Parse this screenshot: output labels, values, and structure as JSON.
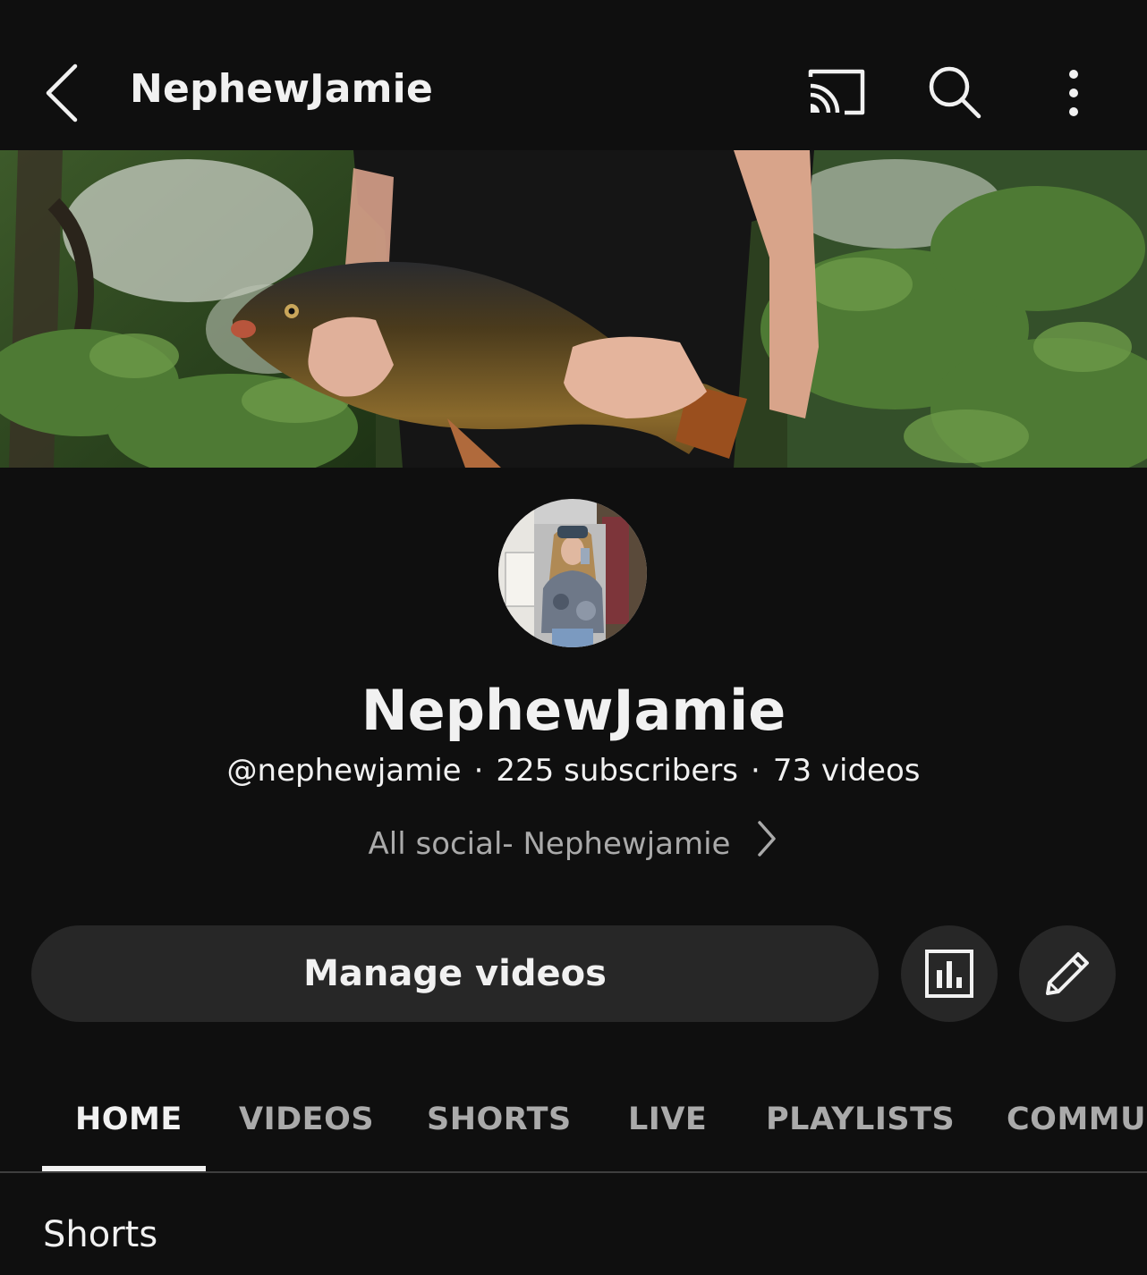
{
  "header": {
    "title": "NephewJamie",
    "icons": [
      "back-arrow-icon",
      "cast-icon",
      "search-icon",
      "more-vert-icon"
    ]
  },
  "channel": {
    "name": "NephewJamie",
    "handle": "@nephewjamie",
    "subscribers": "225 subscribers",
    "videos": "73 videos",
    "separator": "·",
    "link_text": "All social- Nephewjamie"
  },
  "actions": {
    "manage_label": "Manage videos",
    "icons": [
      "analytics-icon",
      "pencil-edit-icon"
    ]
  },
  "tabs": [
    {
      "label": "HOME",
      "active": true
    },
    {
      "label": "VIDEOS",
      "active": false
    },
    {
      "label": "SHORTS",
      "active": false
    },
    {
      "label": "LIVE",
      "active": false
    },
    {
      "label": "PLAYLISTS",
      "active": false
    },
    {
      "label": "COMMUN",
      "active": false
    }
  ],
  "section": {
    "title": "Shorts"
  },
  "colors": {
    "background": "#0f0f0f",
    "surface": "#272727",
    "text_primary": "#f1f1f1",
    "text_secondary": "#aaaaaa",
    "divider": "#3f3f3f"
  }
}
